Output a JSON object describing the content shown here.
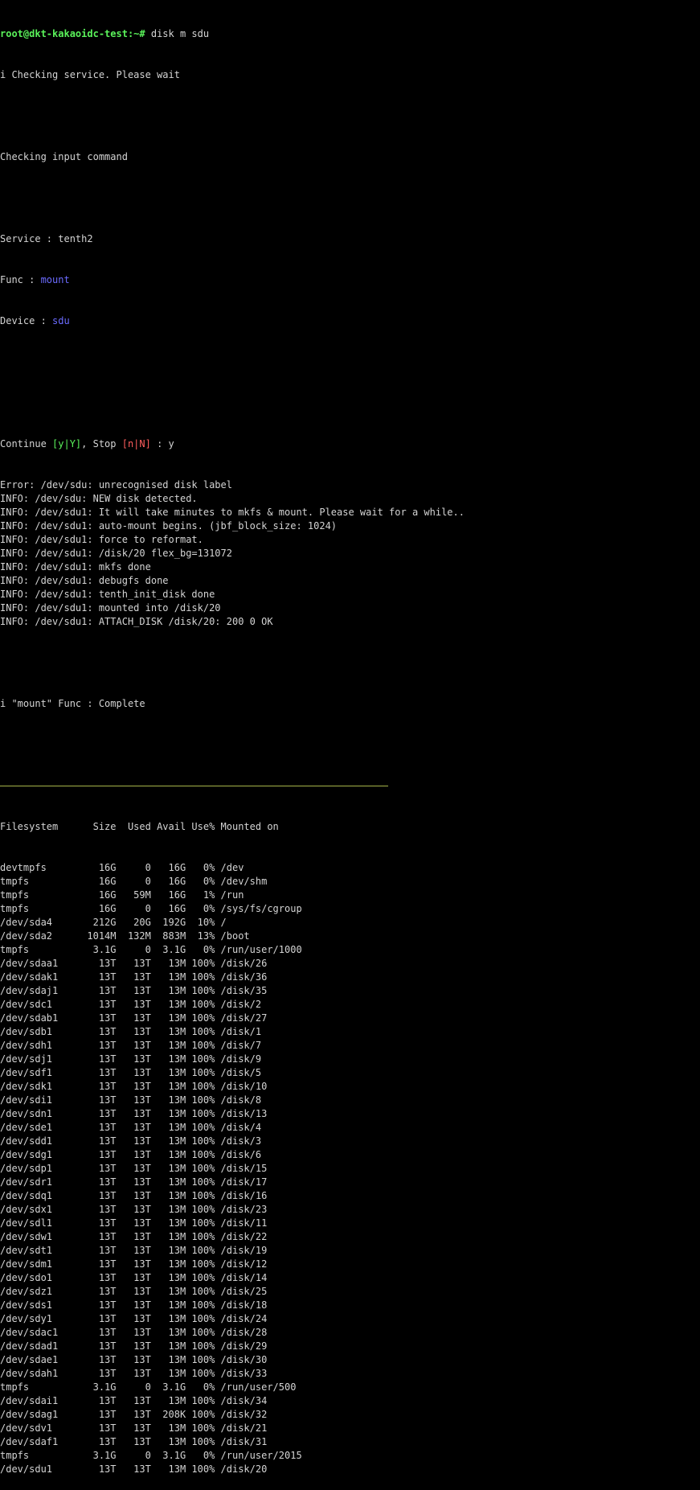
{
  "prompt": "root@dkt-kakaoidc-test:~#",
  "command": " disk m sdu",
  "checking_service": "i Checking service. Please wait",
  "checking_input": "Checking input command",
  "service_line": "Service : tenth2",
  "func_label": "Func : ",
  "func_value": "mount",
  "device_label": "Device : ",
  "device_value": "sdu",
  "continue_prefix": "Continue ",
  "continue_opt": "[y|Y]",
  "stop_prefix": ", Stop ",
  "stop_opt": "[n|N]",
  "continue_suffix": " : y",
  "log_lines": [
    "Error: /dev/sdu: unrecognised disk label",
    "INFO: /dev/sdu: NEW disk detected.",
    "INFO: /dev/sdu1: It will take minutes to mkfs & mount. Please wait for a while..",
    "INFO: /dev/sdu1: auto-mount begins. (jbf_block_size: 1024)",
    "INFO: /dev/sdu1: force to reformat.",
    "INFO: /dev/sdu1: /disk/20 flex_bg=131072",
    "INFO: /dev/sdu1: mkfs done",
    "INFO: /dev/sdu1: debugfs done",
    "INFO: /dev/sdu1: tenth_init_disk done",
    "INFO: /dev/sdu1: mounted into /disk/20",
    "INFO: /dev/sdu1: ATTACH_DISK /disk/20: 200 0 OK"
  ],
  "complete_line": "i \"mount\" Func : Complete",
  "df_header": "Filesystem      Size  Used Avail Use% Mounted on",
  "df_rows": [
    "devtmpfs         16G     0   16G   0% /dev",
    "tmpfs            16G     0   16G   0% /dev/shm",
    "tmpfs            16G   59M   16G   1% /run",
    "tmpfs            16G     0   16G   0% /sys/fs/cgroup",
    "/dev/sda4       212G   20G  192G  10% /",
    "/dev/sda2      1014M  132M  883M  13% /boot",
    "tmpfs           3.1G     0  3.1G   0% /run/user/1000",
    "/dev/sdaa1       13T   13T   13M 100% /disk/26",
    "/dev/sdak1       13T   13T   13M 100% /disk/36",
    "/dev/sdaj1       13T   13T   13M 100% /disk/35",
    "/dev/sdc1        13T   13T   13M 100% /disk/2",
    "/dev/sdab1       13T   13T   13M 100% /disk/27",
    "/dev/sdb1        13T   13T   13M 100% /disk/1",
    "/dev/sdh1        13T   13T   13M 100% /disk/7",
    "/dev/sdj1        13T   13T   13M 100% /disk/9",
    "/dev/sdf1        13T   13T   13M 100% /disk/5",
    "/dev/sdk1        13T   13T   13M 100% /disk/10",
    "/dev/sdi1        13T   13T   13M 100% /disk/8",
    "/dev/sdn1        13T   13T   13M 100% /disk/13",
    "/dev/sde1        13T   13T   13M 100% /disk/4",
    "/dev/sdd1        13T   13T   13M 100% /disk/3",
    "/dev/sdg1        13T   13T   13M 100% /disk/6",
    "/dev/sdp1        13T   13T   13M 100% /disk/15",
    "/dev/sdr1        13T   13T   13M 100% /disk/17",
    "/dev/sdq1        13T   13T   13M 100% /disk/16",
    "/dev/sdx1        13T   13T   13M 100% /disk/23",
    "/dev/sdl1        13T   13T   13M 100% /disk/11",
    "/dev/sdw1        13T   13T   13M 100% /disk/22",
    "/dev/sdt1        13T   13T   13M 100% /disk/19",
    "/dev/sdm1        13T   13T   13M 100% /disk/12",
    "/dev/sdo1        13T   13T   13M 100% /disk/14",
    "/dev/sdz1        13T   13T   13M 100% /disk/25",
    "/dev/sds1        13T   13T   13M 100% /disk/18",
    "/dev/sdy1        13T   13T   13M 100% /disk/24",
    "/dev/sdac1       13T   13T   13M 100% /disk/28",
    "/dev/sdad1       13T   13T   13M 100% /disk/29",
    "/dev/sdae1       13T   13T   13M 100% /disk/30",
    "/dev/sdah1       13T   13T   13M 100% /disk/33",
    "tmpfs           3.1G     0  3.1G   0% /run/user/500",
    "/dev/sdai1       13T   13T   13M 100% /disk/34",
    "/dev/sdag1       13T   13T  208K 100% /disk/32",
    "/dev/sdv1        13T   13T   13M 100% /disk/21",
    "/dev/sdaf1       13T   13T   13M 100% /disk/31",
    "tmpfs           3.1G     0  3.1G   0% /run/user/2015",
    "/dev/sdu1        13T   13T   13M 100% /disk/20"
  ],
  "colors": {
    "background": "#000000",
    "text": "#d4d4d4",
    "prompt": "#5af25a",
    "highlight_blue": "#6b6bff",
    "option_green": "#5af25a",
    "option_red": "#ff5d5d",
    "divider": "#a6b54a"
  }
}
